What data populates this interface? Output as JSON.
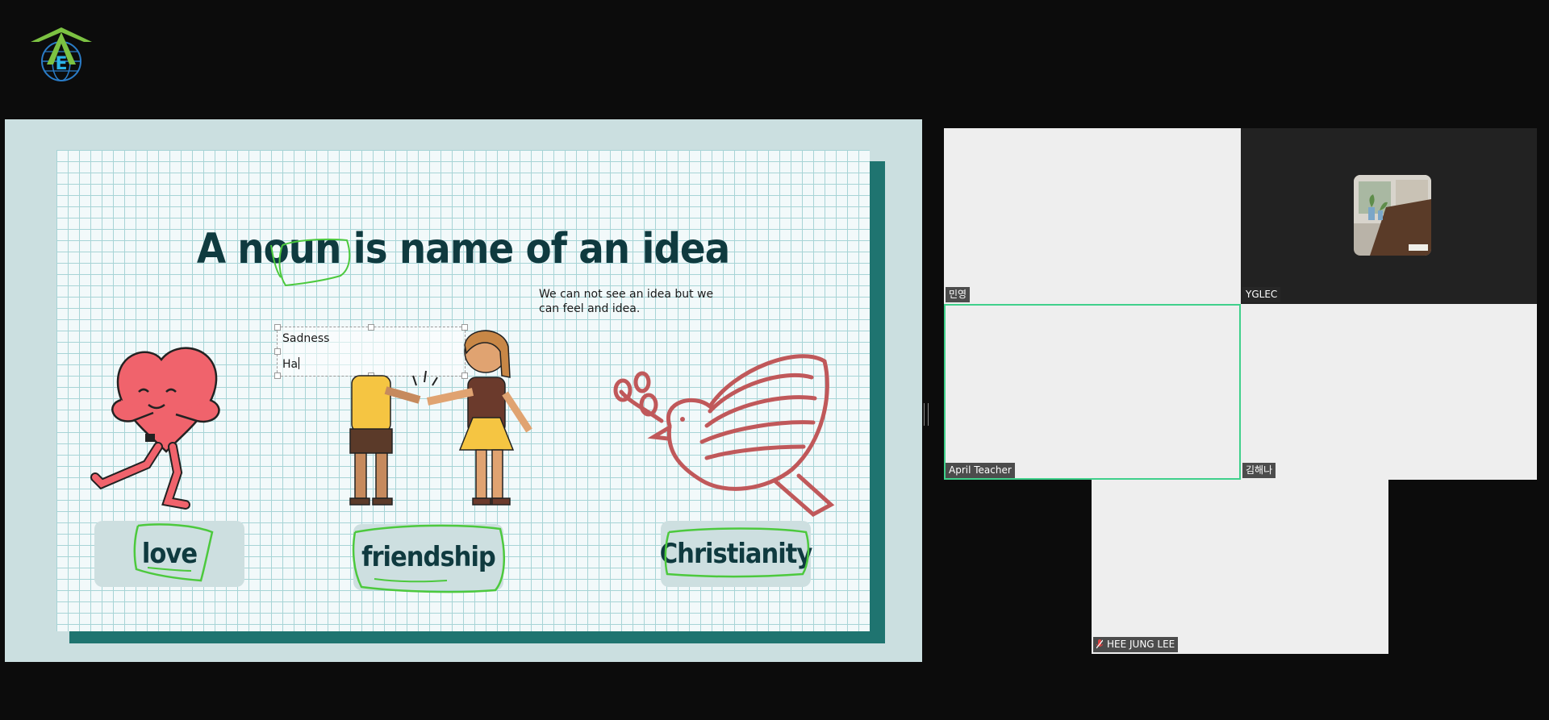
{
  "app": {
    "logo_icon": "academy-globe-logo"
  },
  "slide": {
    "title": "A noun is name of an idea",
    "subtext": "We can not see an idea but we can feel and idea.",
    "textbox": {
      "line1": "Sadness",
      "line2": "Ha"
    },
    "cards": [
      {
        "label": "love",
        "illustration": "hugging-heart"
      },
      {
        "label": "friendship",
        "illustration": "handshake-friends"
      },
      {
        "label": "Christianity",
        "illustration": "dove-with-olive-branch"
      }
    ],
    "colors": {
      "paper": "#f2f9fa",
      "grid": "#a7d4d6",
      "frame": "#cbdfe0",
      "shadow": "#1f7470",
      "title": "#0f3a3f",
      "annotation": "#4cc93d"
    }
  },
  "participants": [
    {
      "name": "민영",
      "style": "light"
    },
    {
      "name": "YGLEC",
      "style": "dark"
    },
    {
      "name": "April Teacher",
      "style": "light",
      "active": true
    },
    {
      "name": "김해나",
      "style": "light"
    },
    {
      "name": "HEE JUNG LEE",
      "style": "light",
      "muted": true
    }
  ]
}
